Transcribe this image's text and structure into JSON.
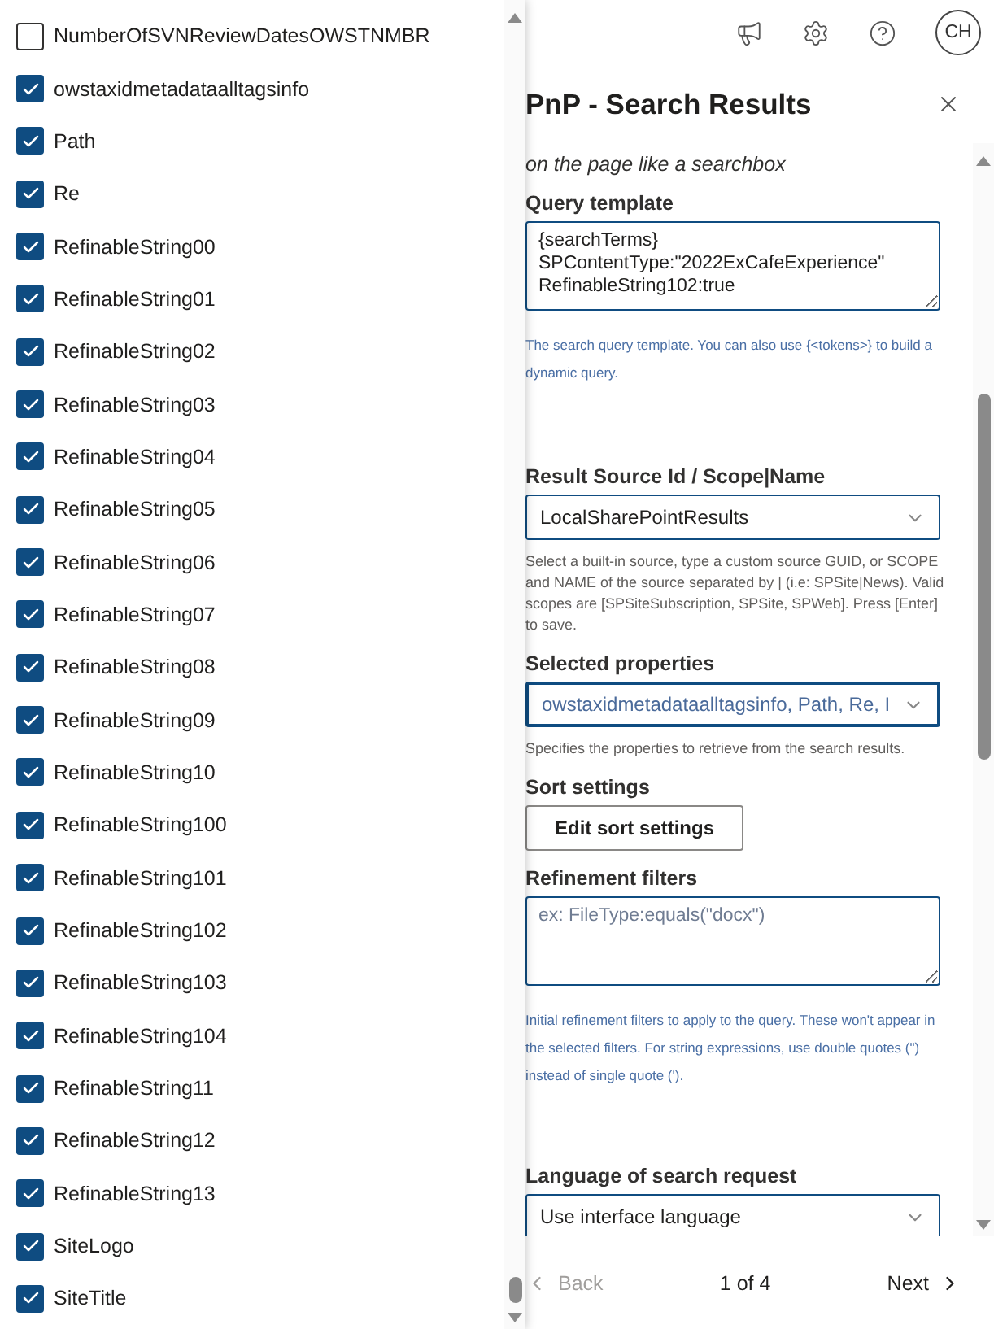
{
  "properties_dropdown": {
    "items": [
      {
        "label": "NumberOfSVNReviewDatesOWSTNMBR",
        "checked": false
      },
      {
        "label": "owstaxidmetadataalltagsinfo",
        "checked": true
      },
      {
        "label": "Path",
        "checked": true
      },
      {
        "label": "Re",
        "checked": true
      },
      {
        "label": "RefinableString00",
        "checked": true
      },
      {
        "label": "RefinableString01",
        "checked": true
      },
      {
        "label": "RefinableString02",
        "checked": true
      },
      {
        "label": "RefinableString03",
        "checked": true
      },
      {
        "label": "RefinableString04",
        "checked": true
      },
      {
        "label": "RefinableString05",
        "checked": true
      },
      {
        "label": "RefinableString06",
        "checked": true
      },
      {
        "label": "RefinableString07",
        "checked": true
      },
      {
        "label": "RefinableString08",
        "checked": true
      },
      {
        "label": "RefinableString09",
        "checked": true
      },
      {
        "label": "RefinableString10",
        "checked": true
      },
      {
        "label": "RefinableString100",
        "checked": true
      },
      {
        "label": "RefinableString101",
        "checked": true
      },
      {
        "label": "RefinableString102",
        "checked": true
      },
      {
        "label": "RefinableString103",
        "checked": true
      },
      {
        "label": "RefinableString104",
        "checked": true
      },
      {
        "label": "RefinableString11",
        "checked": true
      },
      {
        "label": "RefinableString12",
        "checked": true
      },
      {
        "label": "RefinableString13",
        "checked": true
      },
      {
        "label": "SiteLogo",
        "checked": true
      },
      {
        "label": "SiteTitle",
        "checked": true
      }
    ]
  },
  "header": {
    "avatar": "CH"
  },
  "panel": {
    "title": "PnP - Search Results",
    "intro": "on the page like a searchbox",
    "fields": [
      {
        "kind": "textarea",
        "label": "Query template",
        "value": "{searchTerms}\nSPContentType:\"2022ExCafeExperience\"\nRefinableString102:true",
        "help": "The search query template. You can also use {<tokens>} to build a dynamic query."
      },
      {
        "kind": "select",
        "label": "Result Source Id / Scope|Name",
        "value": "LocalSharePointResults",
        "focused": false,
        "help": "Select a built-in source, type a custom source GUID, or SCOPE and NAME of the source separated by | (i.e: SPSite|News). Valid scopes are [SPSiteSubscription, SPSite, SPWeb]. Press [Enter] to save."
      },
      {
        "kind": "select",
        "label": "Selected properties",
        "value": "owstaxidmetadataalltagsinfo, Path, Re, I",
        "focused": true,
        "help": "Specifies the properties to retrieve from the search results."
      },
      {
        "kind": "button",
        "label": "Sort settings",
        "value": "Edit sort settings"
      },
      {
        "kind": "textarea",
        "label": "Refinement filters",
        "placeholder": "ex: FileType:equals(\"docx\")",
        "help": "Initial refinement filters to apply to the query. These won't appear in the selected filters. For string expressions, use double quotes (\") instead of single quote (')."
      },
      {
        "kind": "select",
        "label": "Language of search request",
        "value": "Use interface language",
        "focused": false
      }
    ]
  },
  "footer": {
    "back": {
      "label": "Back",
      "disabled": true
    },
    "page": "1 of 4",
    "next": {
      "label": "Next",
      "disabled": false
    }
  }
}
